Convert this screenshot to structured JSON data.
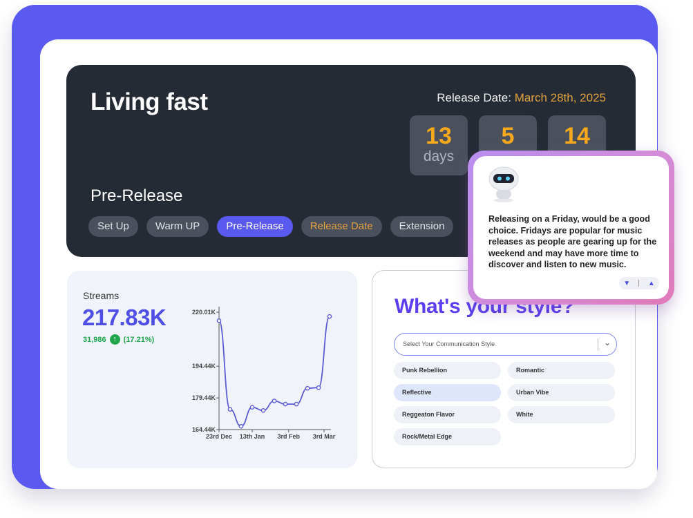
{
  "hero": {
    "title": "Living fast",
    "release_label": "Release Date: ",
    "release_value": "March 28th, 2025",
    "countdown": [
      {
        "value": "13",
        "unit": "days"
      },
      {
        "value": "5",
        "unit": ""
      },
      {
        "value": "14",
        "unit": ""
      }
    ],
    "stage_title": "Pre-Release",
    "stages": [
      "Set Up",
      "Warm UP",
      "Pre-Release",
      "Release Date",
      "Extension"
    ],
    "active_stage": "Pre-Release"
  },
  "streams": {
    "label": "Streams",
    "value": "217.83K",
    "change_abs": "31,986",
    "change_pct": "(17.21%)",
    "up_icon": "arrow-up-icon"
  },
  "chart_data": {
    "type": "line",
    "y_ticks": [
      "220.01K",
      "194.44K",
      "179.44K",
      "164.44K"
    ],
    "x_ticks": [
      "23rd Dec",
      "13th Jan",
      "3rd Feb",
      "3rd Mar"
    ],
    "ylim": [
      164.44,
      220.01
    ],
    "series": [
      {
        "values": [
          216.0,
          174.0,
          166.0,
          175.0,
          173.5,
          178.0,
          176.5,
          176.5,
          184.0,
          184.3,
          218.0
        ],
        "color": "#5b5bd6"
      }
    ]
  },
  "style": {
    "title": "What's your style?",
    "select_placeholder": "Select Your Communication Style",
    "options": [
      {
        "label": "Punk Rebellion",
        "selected": false
      },
      {
        "label": "Romantic",
        "selected": false
      },
      {
        "label": "Reflective",
        "selected": true
      },
      {
        "label": "Urban Vibe",
        "selected": false
      },
      {
        "label": "Reggeaton Flavor",
        "selected": false
      },
      {
        "label": "White",
        "selected": false
      },
      {
        "label": "Rock/Metal Edge",
        "selected": false
      }
    ]
  },
  "popup": {
    "avatar_icon": "robot-avatar-icon",
    "message": "Releasing on a Friday, would be a good choice. Fridays are popular for music releases as people are gearing up for the weekend and may have more time to discover and listen to new music.",
    "feedback_icons": [
      "thumbs-down-icon",
      "thumbs-up-icon"
    ]
  },
  "colors": {
    "brand": "#5a5af0",
    "accent_orange": "#f7a81b",
    "release_gold": "#e2a13f",
    "positive_green": "#1fa64a"
  }
}
